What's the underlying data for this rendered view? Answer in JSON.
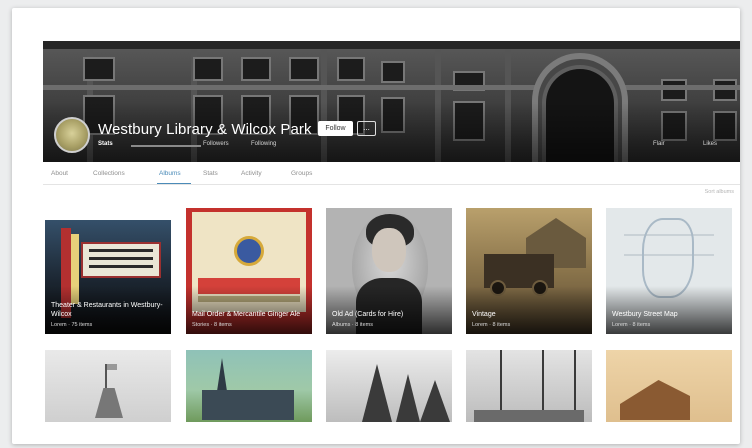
{
  "header": {
    "title": "Westbury Library & Wilcox Park",
    "follow_label": "Follow",
    "more_label": "...",
    "meta": [
      "Stats",
      "Followers",
      "Following",
      "Flair",
      "Likes"
    ]
  },
  "tabs": {
    "items": [
      "About",
      "Collections",
      "Albums",
      "Stats",
      "Activity",
      "Groups"
    ],
    "active_index": 2
  },
  "sort_label": "Sort albums",
  "albums": [
    {
      "title": "Theater & Restaurants in Westbury-Wilcox",
      "meta": "Lorem · 75 items"
    },
    {
      "title": "Mail Order & Mercantile Ginger Ale",
      "meta": "Stories · 8 items"
    },
    {
      "title": "Old Ad (Cards for Hire)",
      "meta": "Albums · 8 items"
    },
    {
      "title": "Vintage",
      "meta": "Lorem · 8 items"
    },
    {
      "title": "Westbury Street Map",
      "meta": "Lorem · 8 items"
    },
    {
      "title": "",
      "meta": ""
    },
    {
      "title": "",
      "meta": ""
    },
    {
      "title": "",
      "meta": ""
    },
    {
      "title": "",
      "meta": ""
    },
    {
      "title": "",
      "meta": ""
    }
  ],
  "colors": {
    "accent": "#4b8bb8",
    "tab_inactive": "#8f8f8f",
    "banner_dark": "#3e3e3e"
  },
  "icons": [
    "avatar-image",
    "more-options-icon"
  ]
}
